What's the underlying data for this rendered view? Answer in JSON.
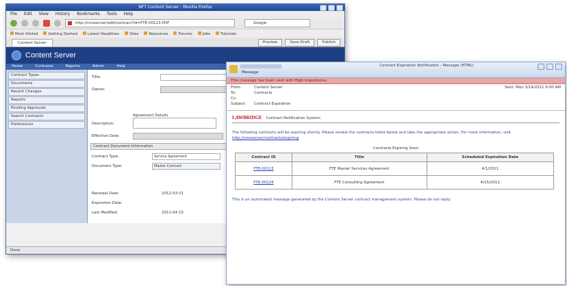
{
  "browser": {
    "title": "NFT Content Server - Mozilla Firefox",
    "menu": [
      "File",
      "Edit",
      "View",
      "History",
      "Bookmarks",
      "Tools",
      "Help"
    ],
    "url": "http://cmsserver/edit/contract?id=FTE-00123-PDF",
    "search_placeholder": "Google",
    "bookmarks": [
      "Most Visited",
      "Getting Started",
      "Latest Headlines",
      "Sites",
      "Resources",
      "Forums",
      "Jobs",
      "Tutorials"
    ],
    "tab_label": "Content Server",
    "tab_buttons": [
      "Preview",
      "Save Draft",
      "Publish"
    ],
    "status": "Done"
  },
  "app": {
    "title": "Content Server",
    "nav": [
      "Home",
      "Contracts",
      "Reports",
      "Admin",
      "Help"
    ],
    "sidebar": [
      "Contract Types",
      "Documents",
      "Recent Changes",
      "Reports",
      "Pending Approvals",
      "Search Contracts",
      "Preferences"
    ],
    "form": {
      "field1_label": "Title:",
      "field2_label": "Owner:",
      "section1_title": "Agreement Details",
      "field3_label": "Description:",
      "field4_label": "Effective Date:",
      "section2_title": "Contract Document Information",
      "field5_label": "Contract Type:",
      "field5_value": "Service Agreement",
      "field6_label": "Document Type:",
      "field6_value": "Master Contract",
      "field7_label": "Renewal Date:",
      "field7_value": "2012-03-01",
      "field8_label": "Expiration Date:",
      "field9_label": "Last Modified:",
      "field9_value": "2011-04-15"
    }
  },
  "email": {
    "title": "Contract Expiration Notification - Message (HTML)",
    "ribbon": "Message",
    "alert": "This message has been sent with High importance.",
    "from_label": "From:",
    "from": "Content Server",
    "to_label": "To:",
    "to": "Contracts",
    "cc_label": "Cc:",
    "subject_label": "Subject:",
    "subject": "Contract Expiration",
    "sent": "Sent: Mon 3/14/2011 9:00 AM",
    "brand": "LAWBRIDGE",
    "brand_sub": "Contract Notification System",
    "intro": "The following contracts will be expiring shortly. Please review the contracts listed below and take the appropriate action. For more information, visit",
    "intro_link": "http://cmsserver/contracts/expiring",
    "table_title": "Contracts Expiring Soon",
    "table_headers": [
      "Contract ID",
      "Title",
      "Scheduled Expiration Date"
    ],
    "table_rows": [
      [
        "FTE-00123",
        "FTE Master Services Agreement",
        "4/1/2011"
      ],
      [
        "FTE-00124",
        "FTE Consulting Agreement",
        "4/15/2011"
      ]
    ],
    "footer": "This is an automated message generated by the Content Server contract management system. Please do not reply."
  }
}
